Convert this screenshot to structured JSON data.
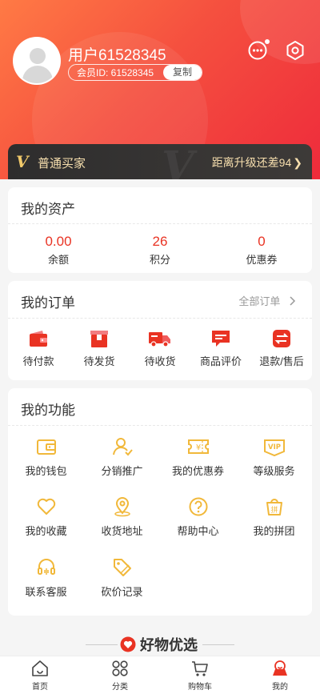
{
  "colors": {
    "accent": "#e93323",
    "gold": "#f1b83a",
    "vip_text": "#f7dfae"
  },
  "user": {
    "name": "用户61528345",
    "member_label": "会员ID: 61528345",
    "copy_label": "复制",
    "msg_icon": "chat-bubble-icon",
    "settings_icon": "settings-hexagon-icon"
  },
  "vip": {
    "badge": "V",
    "level": "普通买家",
    "upgrade": "距离升级还差94",
    "chevron": "❯"
  },
  "assets": {
    "title": "我的资产",
    "items": [
      {
        "value": "0.00",
        "label": "余额"
      },
      {
        "value": "26",
        "label": "积分"
      },
      {
        "value": "0",
        "label": "优惠券"
      }
    ]
  },
  "orders": {
    "title": "我的订单",
    "all_label": "全部订单",
    "items": [
      {
        "label": "待付款",
        "icon": "wallet-icon"
      },
      {
        "label": "待发货",
        "icon": "package-icon"
      },
      {
        "label": "待收货",
        "icon": "truck-icon"
      },
      {
        "label": "商品评价",
        "icon": "comment-icon"
      },
      {
        "label": "退款/售后",
        "icon": "refund-icon"
      }
    ]
  },
  "functions": {
    "title": "我的功能",
    "items": [
      {
        "label": "我的钱包",
        "icon": "wallet-icon"
      },
      {
        "label": "分销推广",
        "icon": "people-icon"
      },
      {
        "label": "我的优惠券",
        "icon": "coupon-icon"
      },
      {
        "label": "等级服务",
        "icon": "vip-icon"
      },
      {
        "label": "我的收藏",
        "icon": "heart-icon"
      },
      {
        "label": "收货地址",
        "icon": "location-icon"
      },
      {
        "label": "帮助中心",
        "icon": "help-icon"
      },
      {
        "label": "我的拼团",
        "icon": "group-buy-icon"
      },
      {
        "label": "联系客服",
        "icon": "headset-icon"
      },
      {
        "label": "砍价记录",
        "icon": "bargain-tag-icon"
      }
    ]
  },
  "recommend": {
    "title": "好物优选"
  },
  "tabbar": {
    "items": [
      {
        "label": "首页",
        "icon": "home-icon"
      },
      {
        "label": "分类",
        "icon": "category-icon"
      },
      {
        "label": "购物车",
        "icon": "cart-icon"
      },
      {
        "label": "我的",
        "icon": "user-icon"
      }
    ]
  }
}
